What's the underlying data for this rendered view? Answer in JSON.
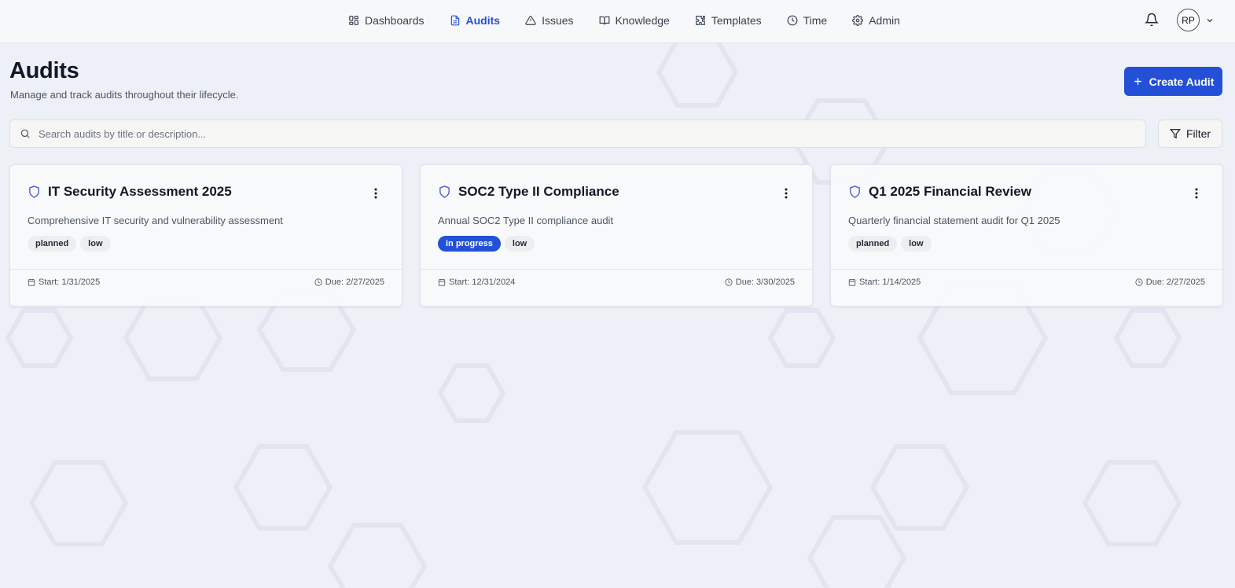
{
  "nav": {
    "items": [
      {
        "label": "Dashboards",
        "icon": "dashboard-icon",
        "active": false
      },
      {
        "label": "Audits",
        "icon": "file-text-icon",
        "active": true
      },
      {
        "label": "Issues",
        "icon": "alert-triangle-icon",
        "active": false
      },
      {
        "label": "Knowledge",
        "icon": "book-icon",
        "active": false
      },
      {
        "label": "Templates",
        "icon": "puzzle-icon",
        "active": false
      },
      {
        "label": "Time",
        "icon": "clock-icon",
        "active": false
      },
      {
        "label": "Admin",
        "icon": "gear-icon",
        "active": false
      }
    ],
    "user_initials": "RP"
  },
  "page": {
    "title": "Audits",
    "subtitle": "Manage and track audits throughout their lifecycle.",
    "create_label": "Create Audit",
    "search_placeholder": "Search audits by title or description...",
    "filter_label": "Filter"
  },
  "audits": [
    {
      "title": "IT Security Assessment 2025",
      "description": "Comprehensive IT security and vulnerability assessment",
      "status": "planned",
      "priority": "low",
      "start": "Start: 1/31/2025",
      "due": "Due: 2/27/2025"
    },
    {
      "title": "SOC2 Type II Compliance",
      "description": "Annual SOC2 Type II compliance audit",
      "status": "in progress",
      "priority": "low",
      "start": "Start: 12/31/2024",
      "due": "Due: 3/30/2025"
    },
    {
      "title": "Q1 2025 Financial Review",
      "description": "Quarterly financial statement audit for Q1 2025",
      "status": "planned",
      "priority": "low",
      "start": "Start: 1/14/2025",
      "due": "Due: 2/27/2025"
    }
  ],
  "colors": {
    "accent": "#2450d8",
    "background": "#eef0f8",
    "shield": "#4f5fd8"
  }
}
